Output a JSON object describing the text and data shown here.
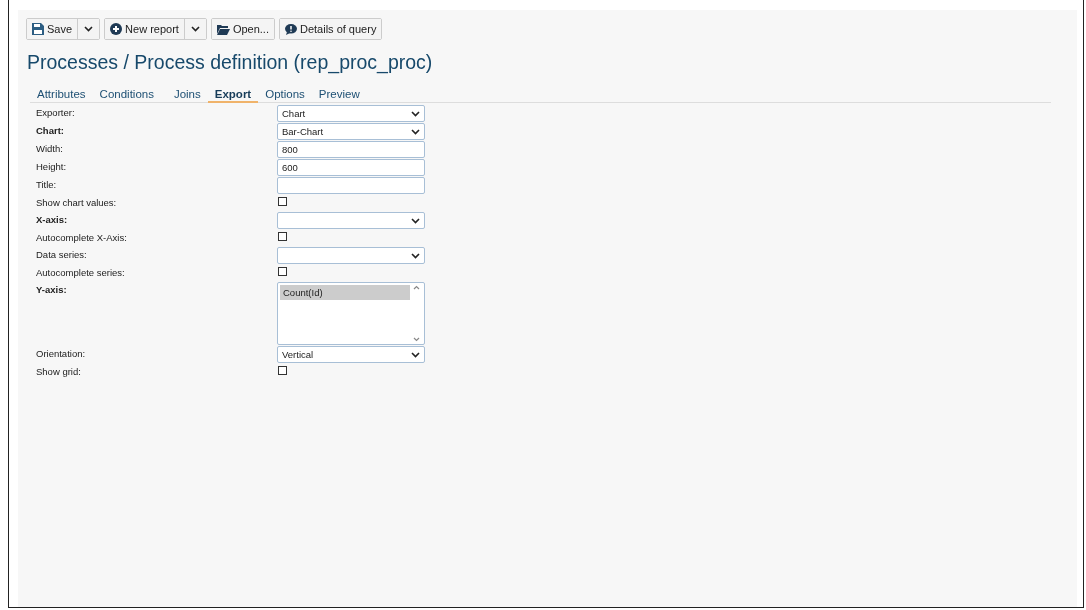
{
  "toolbar": [
    {
      "label": "Save",
      "kind": "save",
      "split": true
    },
    {
      "label": "New report",
      "kind": "create",
      "split": true
    },
    {
      "label": "Open...",
      "kind": "open",
      "split": false
    },
    {
      "label": "Details of query",
      "kind": "details",
      "split": false
    }
  ],
  "title": "Processes / Process definition (rep_proc_proc)",
  "tabs": [
    {
      "label": "Attributes",
      "selected": false
    },
    {
      "label": "Conditions",
      "selected": false
    },
    {
      "label": "Joins",
      "selected": false
    },
    {
      "label": "Export",
      "selected": true
    },
    {
      "label": "Options",
      "selected": false
    },
    {
      "label": "Preview",
      "selected": false
    }
  ],
  "fields": [
    {
      "label": "Exporter:",
      "required": false,
      "kind": "select",
      "value": "Chart"
    },
    {
      "label": "Chart:",
      "required": true,
      "kind": "select",
      "value": "Bar-Chart"
    },
    {
      "label": "Width:",
      "required": false,
      "kind": "text",
      "value": "800"
    },
    {
      "label": "Height:",
      "required": false,
      "kind": "text",
      "value": "600"
    },
    {
      "label": "Title:",
      "required": false,
      "kind": "text"
    },
    {
      "label": "Show chart values:",
      "required": false,
      "kind": "checkbox",
      "checked": false
    },
    {
      "label": "X-axis:",
      "required": true,
      "kind": "select"
    },
    {
      "label": "Autocomplete X-Axis:",
      "required": false,
      "kind": "checkbox",
      "checked": false
    },
    {
      "label": "Data series:",
      "required": false,
      "kind": "select"
    },
    {
      "label": "Autocomplete series:",
      "required": false,
      "kind": "checkbox",
      "checked": false
    },
    {
      "label": "Y-axis:",
      "required": true,
      "kind": "listbox",
      "items": [
        {
          "label": "Count(Id)",
          "selected": true
        }
      ]
    },
    {
      "label": "Orientation:",
      "required": false,
      "kind": "select",
      "value": "Vertical"
    },
    {
      "label": "Show grid:",
      "required": false,
      "kind": "checkbox",
      "checked": false
    }
  ]
}
